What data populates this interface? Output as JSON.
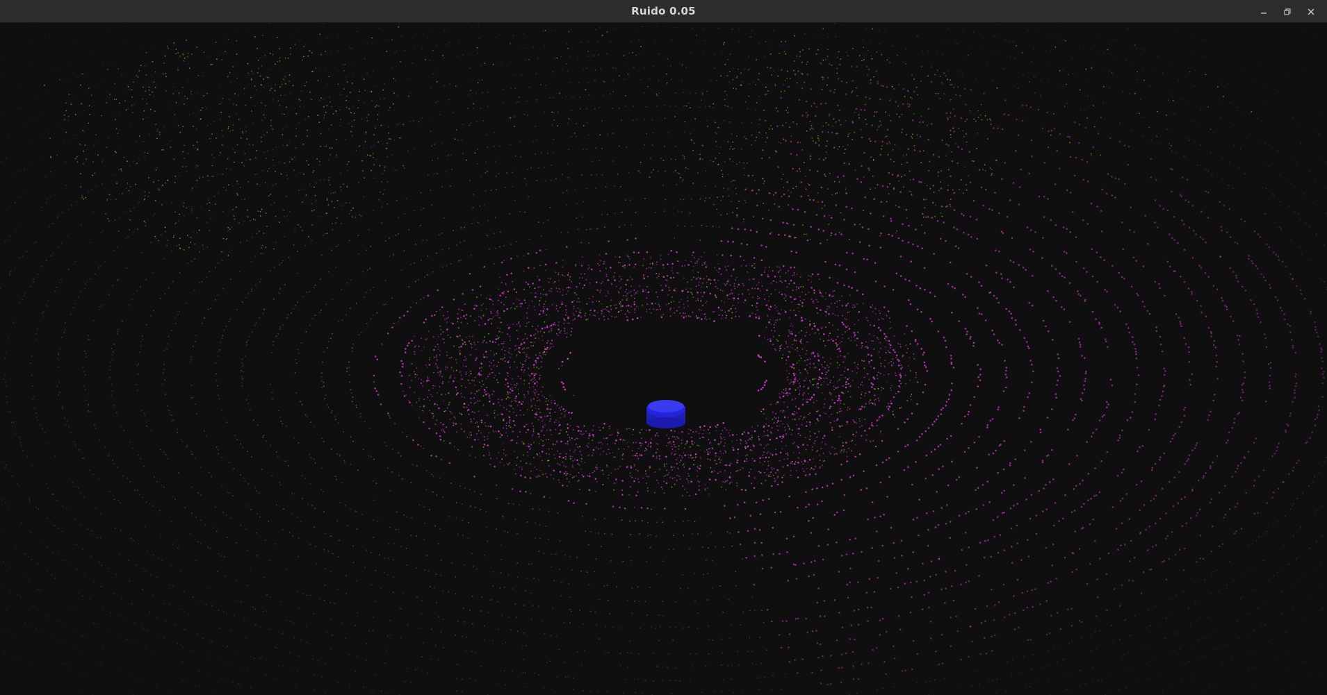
{
  "window": {
    "title": "Ruido 0.05",
    "controls": {
      "minimize_icon": "minimize-icon",
      "maximize_icon": "restore-icon",
      "close_icon": "close-icon"
    }
  },
  "colors": {
    "titlebar": "#2c2c2c",
    "title_text": "#d6d6d6",
    "background": "#0f0f10",
    "ring_points": "#d23cd2",
    "noise_points": "#9ccc1e",
    "sensor_object": "#2626e6"
  }
}
